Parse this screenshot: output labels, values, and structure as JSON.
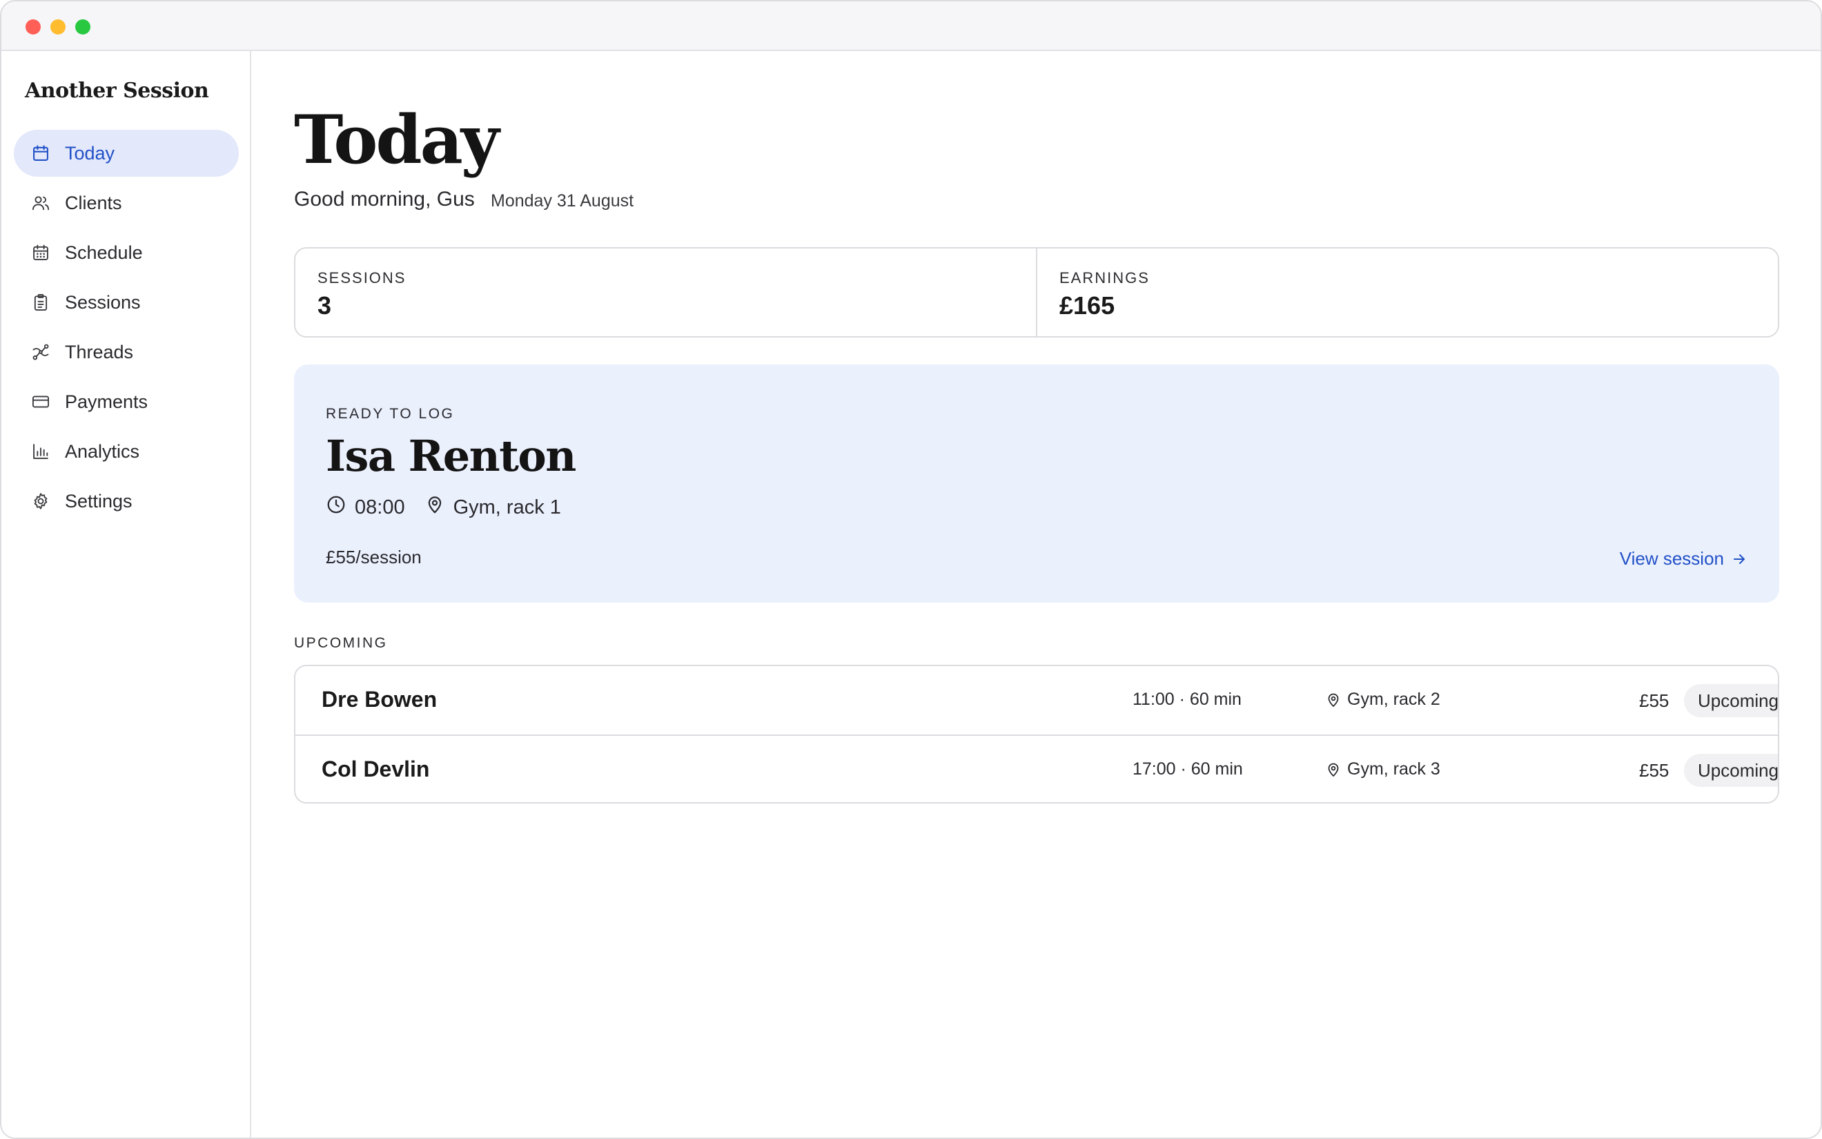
{
  "app": {
    "name": "Another Session"
  },
  "sidebar": {
    "items": [
      {
        "label": "Today",
        "icon": "calendar-icon",
        "active": true
      },
      {
        "label": "Clients",
        "icon": "users-icon"
      },
      {
        "label": "Schedule",
        "icon": "calendar-grid-icon"
      },
      {
        "label": "Sessions",
        "icon": "clipboard-icon"
      },
      {
        "label": "Threads",
        "icon": "threads-icon"
      },
      {
        "label": "Payments",
        "icon": "credit-card-icon"
      },
      {
        "label": "Analytics",
        "icon": "bar-chart-icon"
      },
      {
        "label": "Settings",
        "icon": "gear-icon"
      }
    ]
  },
  "header": {
    "title": "Today",
    "greeting": "Good morning, Gus",
    "date": "Monday 31 August"
  },
  "stats": {
    "sessions": {
      "label": "SESSIONS",
      "value": "3"
    },
    "earnings": {
      "label": "EARNINGS",
      "value": "£165"
    }
  },
  "ready": {
    "kicker": "READY TO LOG",
    "client": "Isa Renton",
    "time": "08:00",
    "location": "Gym, rack 1",
    "rate": "£55/session",
    "action": "View session"
  },
  "upcoming": {
    "label": "UPCOMING",
    "rows": [
      {
        "client": "Dre Bowen",
        "time": "11:00 · 60 min",
        "location": "Gym, rack 2",
        "price": "£55",
        "status": "Upcoming"
      },
      {
        "client": "Col Devlin",
        "time": "17:00 · 60 min",
        "location": "Gym, rack 3",
        "price": "£55",
        "status": "Upcoming"
      }
    ]
  },
  "colors": {
    "accent": "#2251c7",
    "active_bg": "#e3e8fb",
    "hero_bg": "#ebf0fd",
    "border": "#dcdce0"
  }
}
